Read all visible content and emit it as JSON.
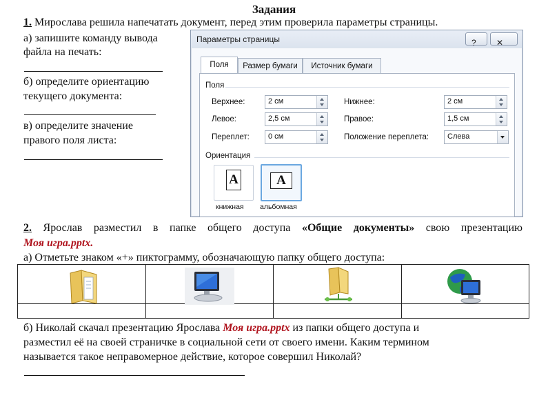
{
  "title": "Задания",
  "task1": {
    "number": "1.",
    "text": "Мирослава решила напечатать документ, перед этим проверила параметры страницы.",
    "a_line1": "а) запишите команду вывода",
    "a_line2": "файла на печать:",
    "b_line1": "б) определите ориентацию",
    "b_line2": "текущего документа:",
    "c_line1": "в) определите значение",
    "c_line2": "правого поля листа:"
  },
  "dialog": {
    "title": "Параметры страницы",
    "help_glyph": "?",
    "close_glyph": "✕",
    "tabs": [
      "Поля",
      "Размер бумаги",
      "Источник бумаги"
    ],
    "group_fields": "Поля",
    "fields": {
      "top_label": "Верхнее:",
      "top_value": "2 см",
      "bottom_label": "Нижнее:",
      "bottom_value": "2 см",
      "left_label": "Левое:",
      "left_value": "2,5 см",
      "right_label": "Правое:",
      "right_value": "1,5 см",
      "gutter_label": "Переплет:",
      "gutter_value": "0 см",
      "gutter_pos_label": "Положение переплета:",
      "gutter_pos_value": "Слева"
    },
    "group_orientation": "Ориентация",
    "orientation": {
      "portrait_label": "книжная",
      "landscape_label": "альбомная",
      "glyph": "A",
      "selected": "альбомная"
    }
  },
  "task2": {
    "number": "2.",
    "text_before": "Ярослав разместил в папке общего доступа",
    "folder_name": "«Общие документы»",
    "text_after": "свою презентацию",
    "file_name": "Моя игра.pptx.",
    "a_text": "а) Отметьте знаком «+» пиктограмму, обозначающую папку общего доступа:",
    "icons": [
      "folder-icon",
      "computer-icon",
      "shared-folder-icon",
      "network-globe-icon"
    ],
    "b_line1_before": "б) Николай скачал презентацию Ярослава",
    "b_file": "Моя игра.pptx",
    "b_line1_after": "из папки общего доступа и",
    "b_line2": "разместил её на своей страничке в социальной сети от своего имени. Каким термином",
    "b_line3": "называется такое неправомерное действие, которое совершил Николай?"
  },
  "colors": {
    "accent_red": "#b0141e",
    "dialog_border": "#8c9bb1",
    "selection_blue": "#6aa7e0"
  }
}
